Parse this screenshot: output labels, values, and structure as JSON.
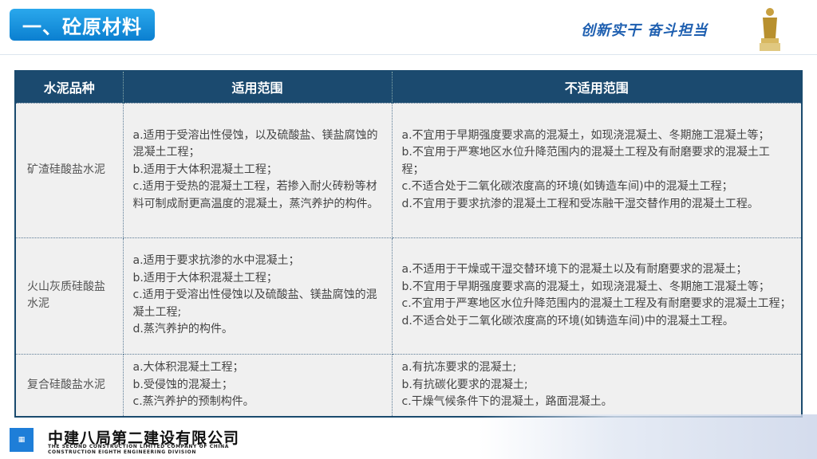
{
  "header": {
    "title": "一、砼原材料",
    "slogan": "创新实干 奋斗担当"
  },
  "table": {
    "columns": [
      "水泥品种",
      "适用范围",
      "不适用范围"
    ],
    "rows": [
      {
        "kind": "矿渣硅酸盐水泥",
        "suitable": [
          "a.适用于受溶出性侵蚀，以及硫酸盐、镁盐腐蚀的混凝土工程；",
          "b.适用于大体积混凝土工程；",
          "c.适用于受热的混凝土工程，若掺入耐火砖粉等材料可制成耐更高温度的混凝土，蒸汽养护的构件。"
        ],
        "unsuitable": [
          "a.不宜用于早期强度要求高的混凝土，如现浇混凝土、冬期施工混凝土等；",
          "b.不宜用于严寒地区水位升降范围内的混凝土工程及有耐磨要求的混凝土工程；",
          "c.不适合处于二氧化碳浓度高的环境(如铸造车间)中的混凝土工程；",
          "d.不宜用于要求抗渗的混凝土工程和受冻融干湿交替作用的混凝土工程。"
        ]
      },
      {
        "kind": "火山灰质硅酸盐水泥",
        "suitable": [
          "a.适用于要求抗渗的水中混凝土；",
          "b.适用于大体积混凝土工程；",
          "c.适用于受溶出性侵蚀以及硫酸盐、镁盐腐蚀的混凝土工程;",
          "d.蒸汽养护的构件。"
        ],
        "unsuitable": [
          "a.不适用于干燥或干湿交替环境下的混凝土以及有耐磨要求的混凝土；",
          "b.不宜用于早期强度要求高的混凝土，如现浇混凝土、冬期施工混凝土等；",
          "c.不宜用于严寒地区水位升降范围内的混凝土工程及有耐磨要求的混凝土工程；",
          "d.不适合处于二氧化碳浓度高的环境(如铸造车间)中的混凝土工程。"
        ]
      },
      {
        "kind": "复合硅酸盐水泥",
        "suitable": [
          "a.大体积混凝土工程；",
          "b.受侵蚀的混凝土；",
          "c.蒸汽养护的预制构件。"
        ],
        "unsuitable": [
          "a.有抗冻要求的混凝土;",
          "b.有抗碳化要求的混凝土;",
          "c.干燥气候条件下的混凝土，路面混凝土。"
        ]
      }
    ]
  },
  "footer": {
    "logo_text": "CSCEC",
    "company_cn": "中建八局第二建设有限公司",
    "company_en_1": "THE SECOND CONSTRUCTION LIMITED COMPANY OF CHINA",
    "company_en_2": "CONSTRUCTION EIGHTH ENGINEERING DIVISION"
  }
}
